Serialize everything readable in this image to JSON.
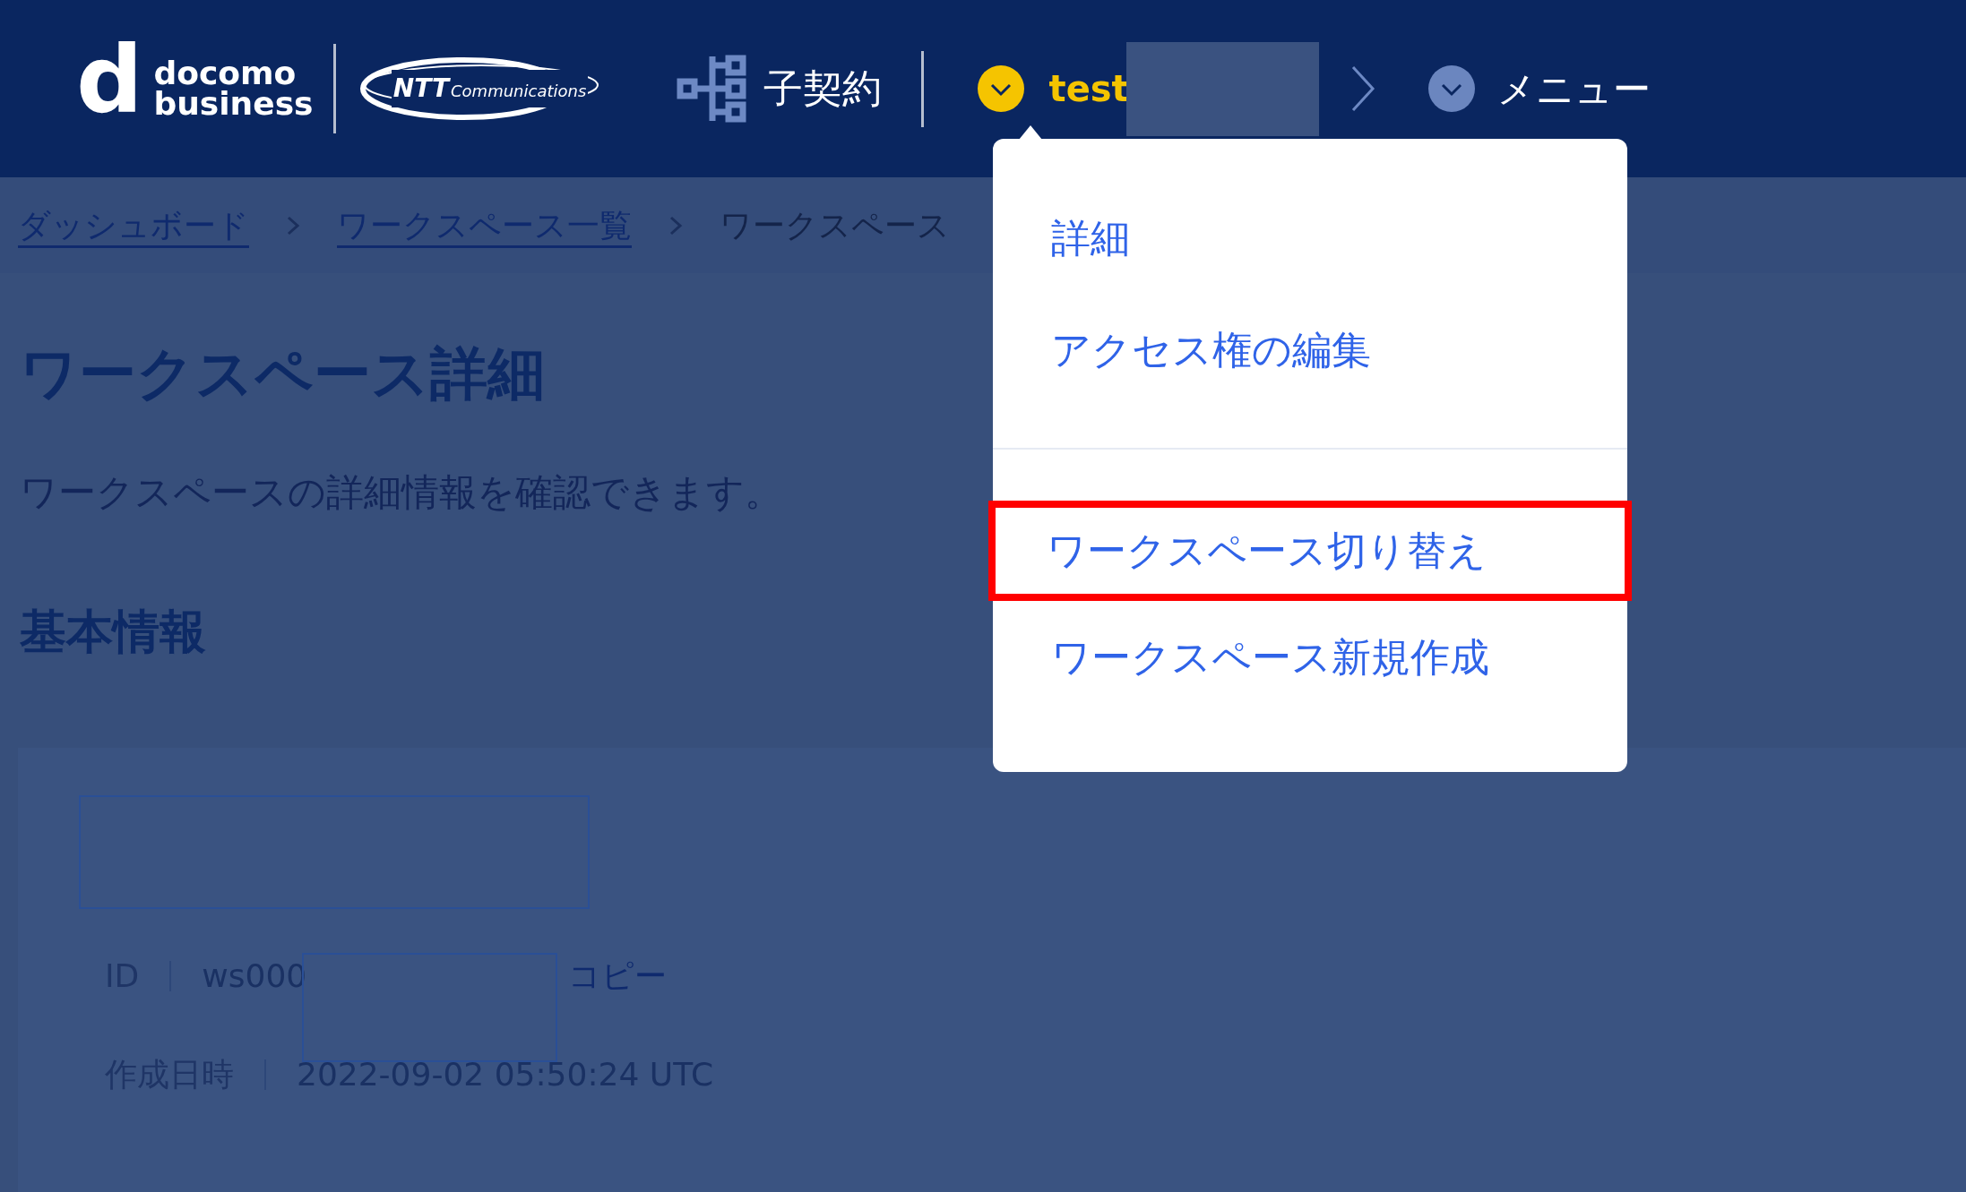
{
  "header": {
    "logo": {
      "mark": "d",
      "line_1": "docomo",
      "line_2": "business",
      "partner_name": "NTT",
      "partner_sub": "Communications"
    },
    "contract_link": "子契約",
    "workspace": {
      "label": "test",
      "expanded": true
    },
    "menu": {
      "label": "メニュー"
    }
  },
  "dropdown": {
    "items": [
      {
        "label": "詳細",
        "highlighted": false
      },
      {
        "label": "アクセス権の編集",
        "highlighted": false
      },
      {
        "label": "ワークスペース切り替え",
        "highlighted": true
      },
      {
        "label": "ワークスペース新規作成",
        "highlighted": false
      }
    ]
  },
  "breadcrumb": [
    {
      "label": "ダッシュボード",
      "kind": "link"
    },
    {
      "label": "ワークスペース一覧",
      "kind": "link"
    },
    {
      "label": "ワークスペース",
      "kind": "current"
    }
  ],
  "page": {
    "title": "ワークスペース詳細",
    "description": "ワークスペースの詳細情報を確認できます。",
    "section_title": "基本情報"
  },
  "details": [
    {
      "label": "ID",
      "value": "ws000",
      "action": "コピー"
    },
    {
      "label": "作成日時",
      "value": "2022-09-02 05:50:24 UTC"
    }
  ]
}
